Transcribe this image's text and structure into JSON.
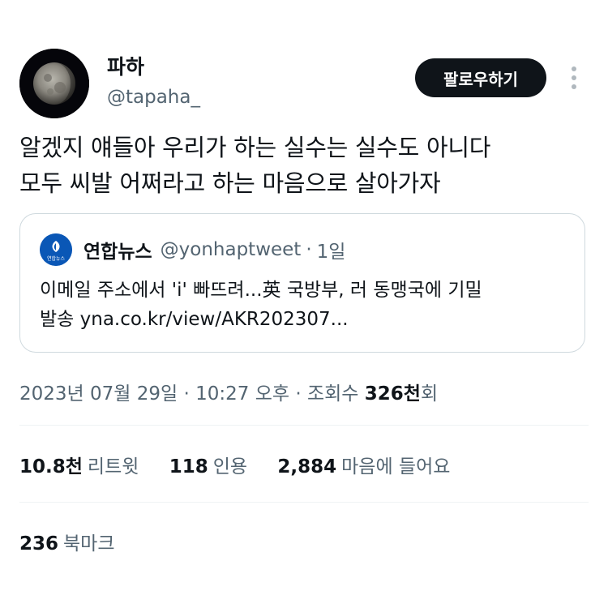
{
  "author": {
    "display_name": "파하",
    "handle": "@tapaha_"
  },
  "follow_button_label": "팔로우하기",
  "tweet_text_lines": [
    "알겠지 얘들아 우리가 하는 실수는 실수도 아니다",
    "모두 씨발 어쩌라고 하는 마음으로 살아가자"
  ],
  "quote": {
    "avatar_text": "연합뉴스",
    "name": "연합뉴스",
    "handle": "@yonhaptweet",
    "separator": "·",
    "time": "1일",
    "text_lines": [
      "이메일 주소에서 'i' 빠뜨려...英 국방부, 러 동맹국에 기밀",
      "발송 yna.co.kr/view/AKR202307..."
    ]
  },
  "meta": {
    "date": "2023년 07월 29일",
    "sep1": "·",
    "time": "10:27 오후",
    "sep2": "·",
    "views_label": "조회수",
    "views_count": "326천",
    "views_suffix": "회"
  },
  "stats": {
    "retweets_value": "10.8천",
    "retweets_label": "리트윗",
    "quotes_value": "118",
    "quotes_label": "인용",
    "likes_value": "2,884",
    "likes_label": "마음에 들어요"
  },
  "bookmarks": {
    "value": "236",
    "label": "북마크"
  },
  "colors": {
    "text_primary": "#0f1419",
    "text_secondary": "#536471",
    "border": "#cfd9de",
    "divider": "#eff3f4",
    "button_bg": "#0f1419",
    "button_text": "#ffffff",
    "quote_avatar_bg": "#0a57b6"
  },
  "icons": {
    "avatar": "moon-avatar",
    "more": "more-vertical-icon",
    "quote_avatar": "yonhap-logo"
  }
}
